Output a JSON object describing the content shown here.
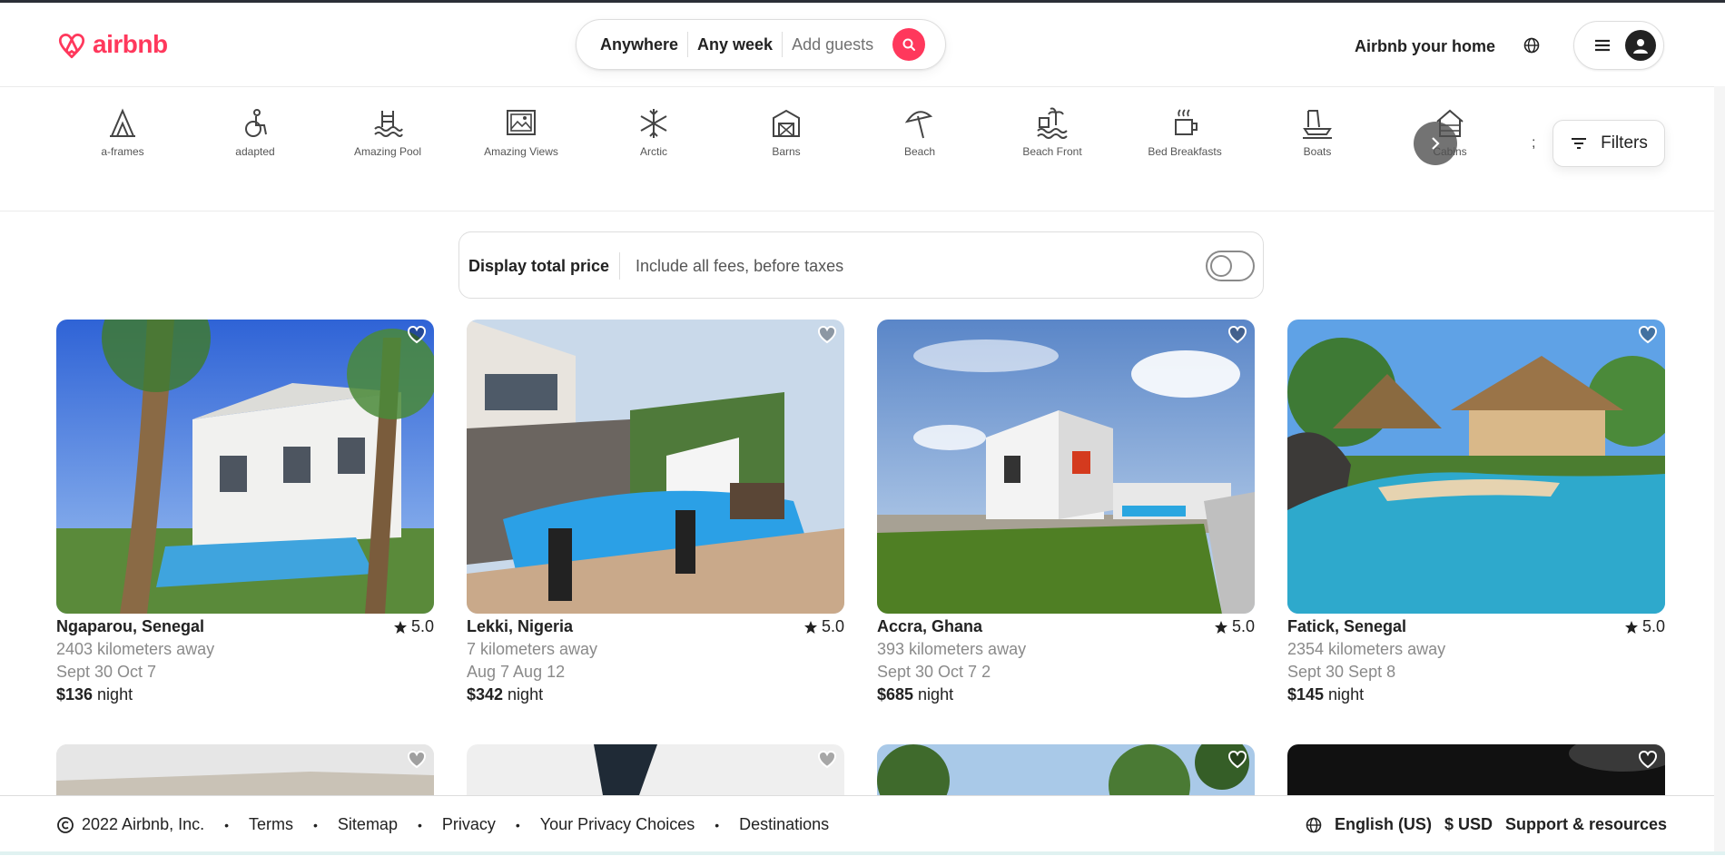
{
  "header": {
    "logo_text": "airbnb",
    "search": {
      "anywhere": "Anywhere",
      "any_week": "Any week",
      "add_guests": "Add guests"
    },
    "host_link": "Airbnb your home"
  },
  "categories": [
    {
      "label": "a-frames",
      "icon": "a-frame-icon"
    },
    {
      "label": "adapted",
      "icon": "accessible-icon"
    },
    {
      "label": "Amazing Pool",
      "icon": "pool-icon"
    },
    {
      "label": "Amazing Views",
      "icon": "views-icon"
    },
    {
      "label": "Arctic",
      "icon": "snowflake-icon"
    },
    {
      "label": "Barns",
      "icon": "barn-icon"
    },
    {
      "label": "Beach",
      "icon": "umbrella-icon"
    },
    {
      "label": "Beach Front",
      "icon": "beachfront-icon"
    },
    {
      "label": "Bed Breakfasts",
      "icon": "coffee-icon"
    },
    {
      "label": "Boats",
      "icon": "boat-icon"
    },
    {
      "label": "Cabins",
      "icon": "cabin-icon"
    }
  ],
  "category_trailing": ";",
  "filters_label": "Filters",
  "price_toggle": {
    "title": "Display total price",
    "subtitle": "Include all fees, before taxes",
    "on": false
  },
  "listings": [
    {
      "location": "Ngaparou, Senegal",
      "rating": "5.0",
      "distance": "2403 kilometers away",
      "dates": "Sept 30 Oct 7",
      "price": "$136",
      "unit": " night"
    },
    {
      "location": "Lekki, Nigeria",
      "rating": "5.0",
      "distance": "7 kilometers away",
      "dates": "Aug 7 Aug 12",
      "price": "$342",
      "unit": " night"
    },
    {
      "location": "Accra, Ghana",
      "rating": "5.0",
      "distance": "393 kilometers away",
      "dates": "Sept 30 Oct 7 2",
      "price": "$685",
      "unit": " night"
    },
    {
      "location": "Fatick, Senegal",
      "rating": "5.0",
      "distance": "2354 kilometers away",
      "dates": "Sept 30 Sept 8",
      "price": "$145",
      "unit": " night"
    }
  ],
  "footer": {
    "copyright": "2022 Airbnb, Inc.",
    "links": [
      "Terms",
      "Sitemap",
      "Privacy",
      "Your Privacy Choices",
      "Destinations"
    ],
    "language": "English (US)",
    "currency": "$ USD",
    "support": "Support & resources"
  },
  "colors": {
    "brand": "#ff385c"
  }
}
